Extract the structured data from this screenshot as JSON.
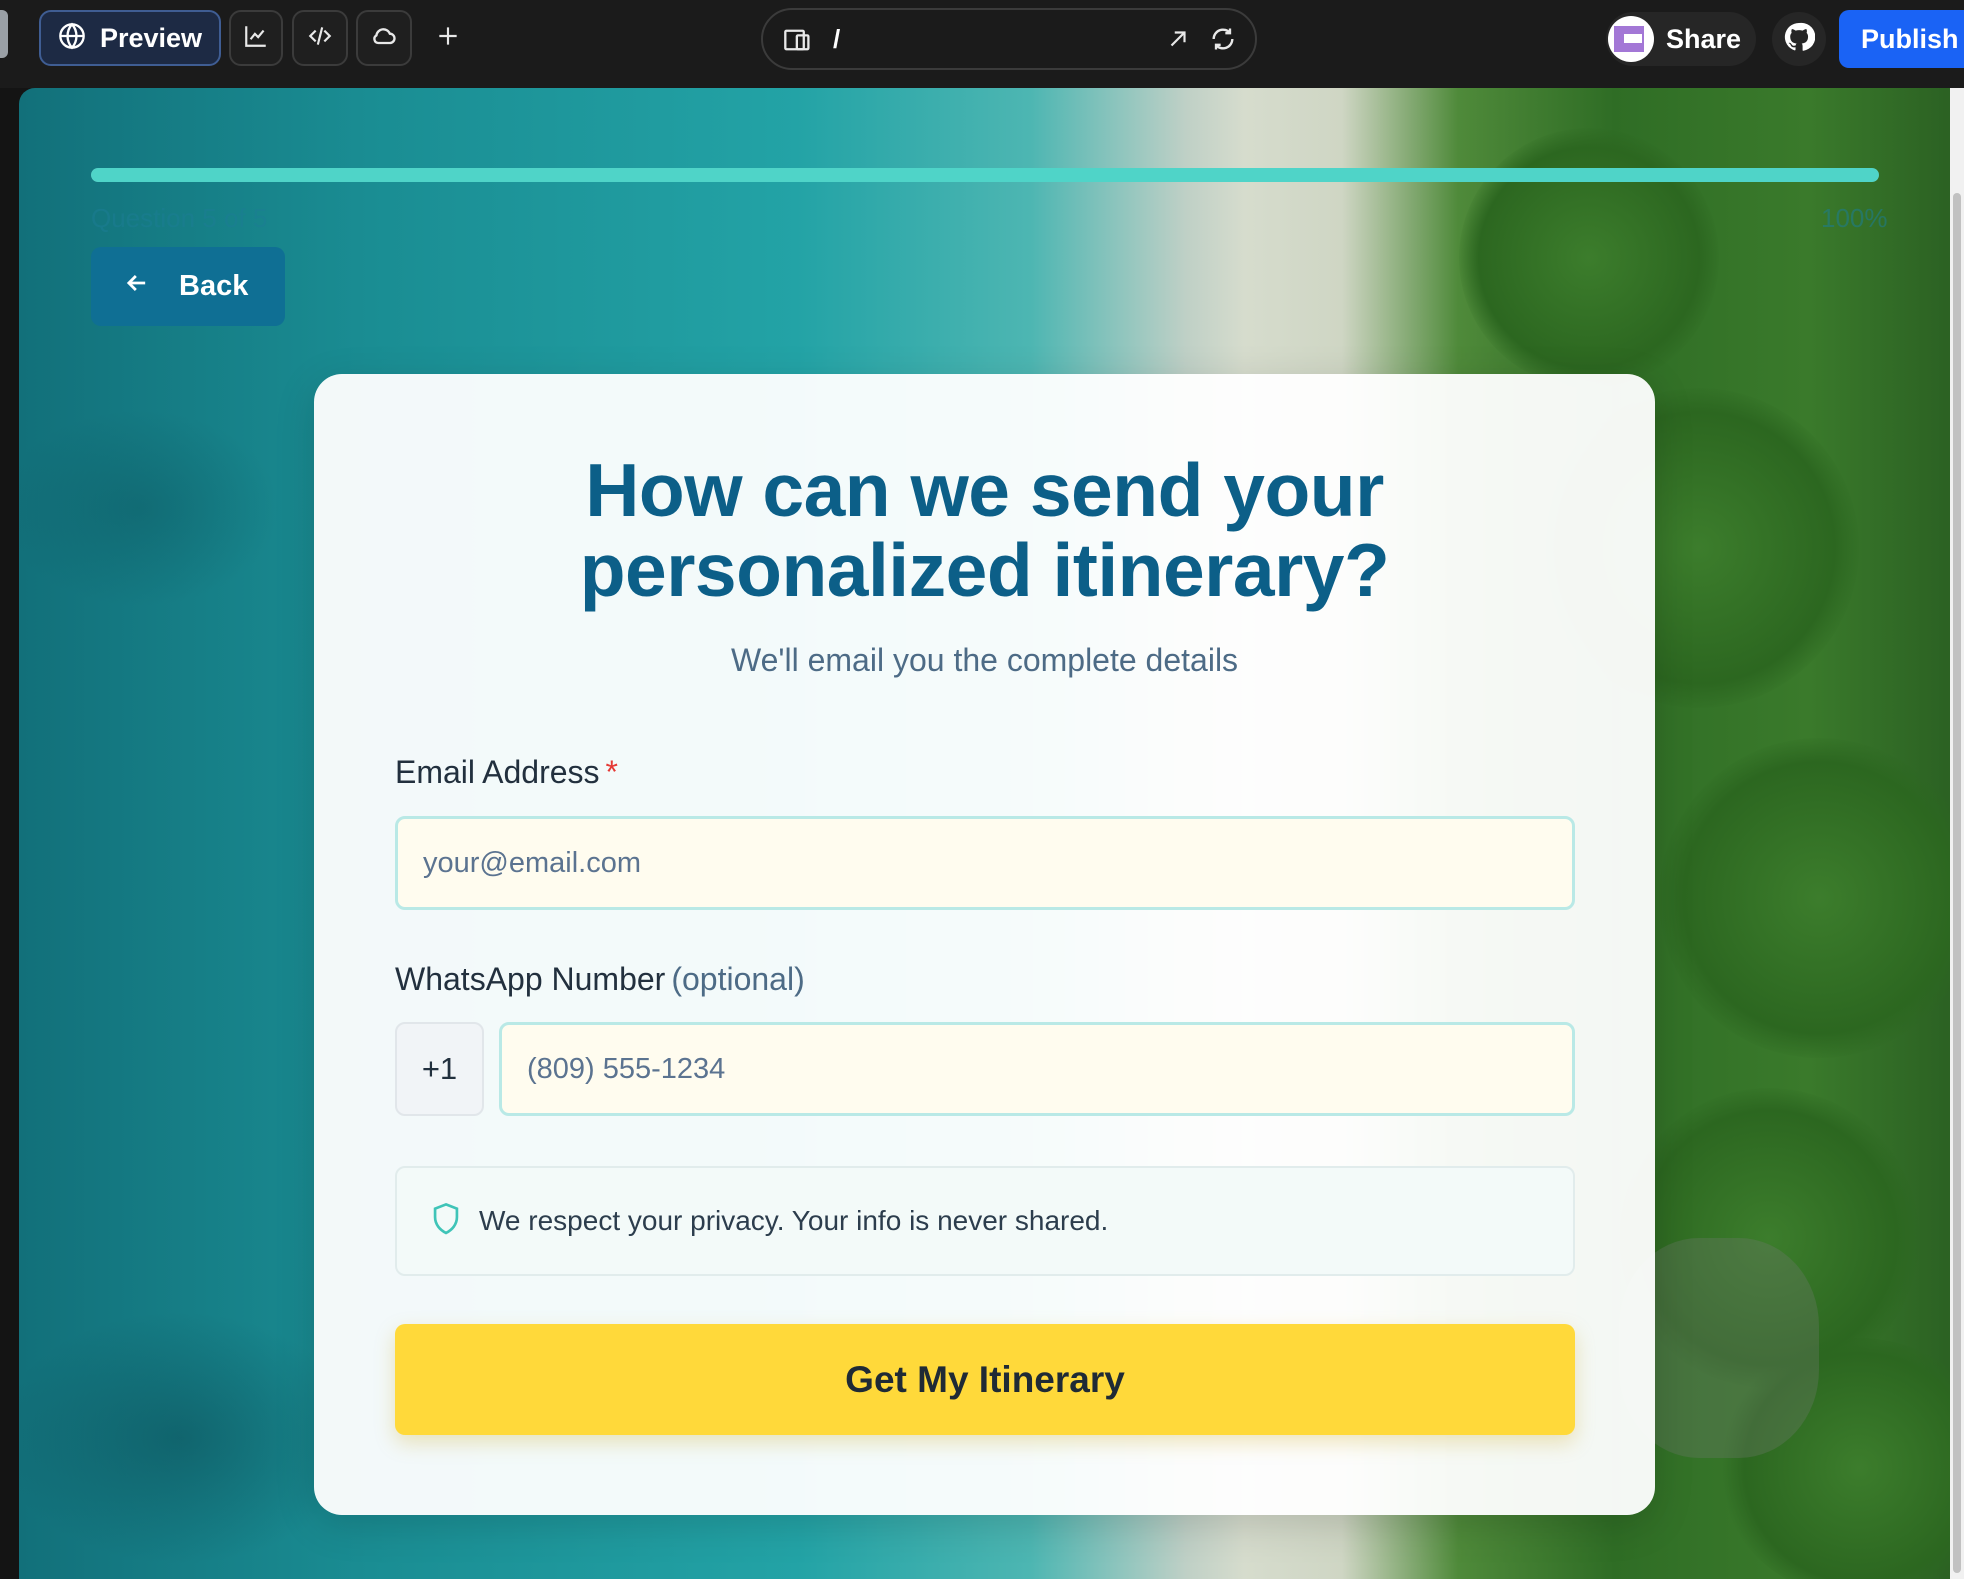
{
  "toolbar": {
    "preview_label": "Preview",
    "url_path": "/",
    "share_label": "Share",
    "publish_label": "Publish"
  },
  "progress": {
    "question_label": "Question 5 of 5",
    "percent_label": "100%",
    "percent_value": 100
  },
  "back_label": "Back",
  "card": {
    "title_line1": "How can we send your",
    "title_line2": "personalized itinerary?",
    "subtitle": "We'll email you the complete details",
    "email_label": "Email Address",
    "email_required_mark": "*",
    "email_placeholder": "your@email.com",
    "whatsapp_label": "WhatsApp Number",
    "whatsapp_optional": "(optional)",
    "country_code": "+1",
    "phone_placeholder": "(809) 555-1234",
    "privacy_text": "We respect your privacy. Your info is never shared.",
    "cta_label": "Get My Itinerary"
  },
  "colors": {
    "title": "#0c5f88",
    "cta": "#ffd93a",
    "progress_fill": "#4fd4c8",
    "back_button": "#0f6f94",
    "publish_button": "#1a63f5"
  },
  "icons": [
    "globe-icon",
    "analytics-icon",
    "code-icon",
    "cloud-icon",
    "plus-icon",
    "device-icon",
    "open-external-icon",
    "reload-icon",
    "github-icon",
    "arrow-left-icon",
    "shield-icon"
  ]
}
